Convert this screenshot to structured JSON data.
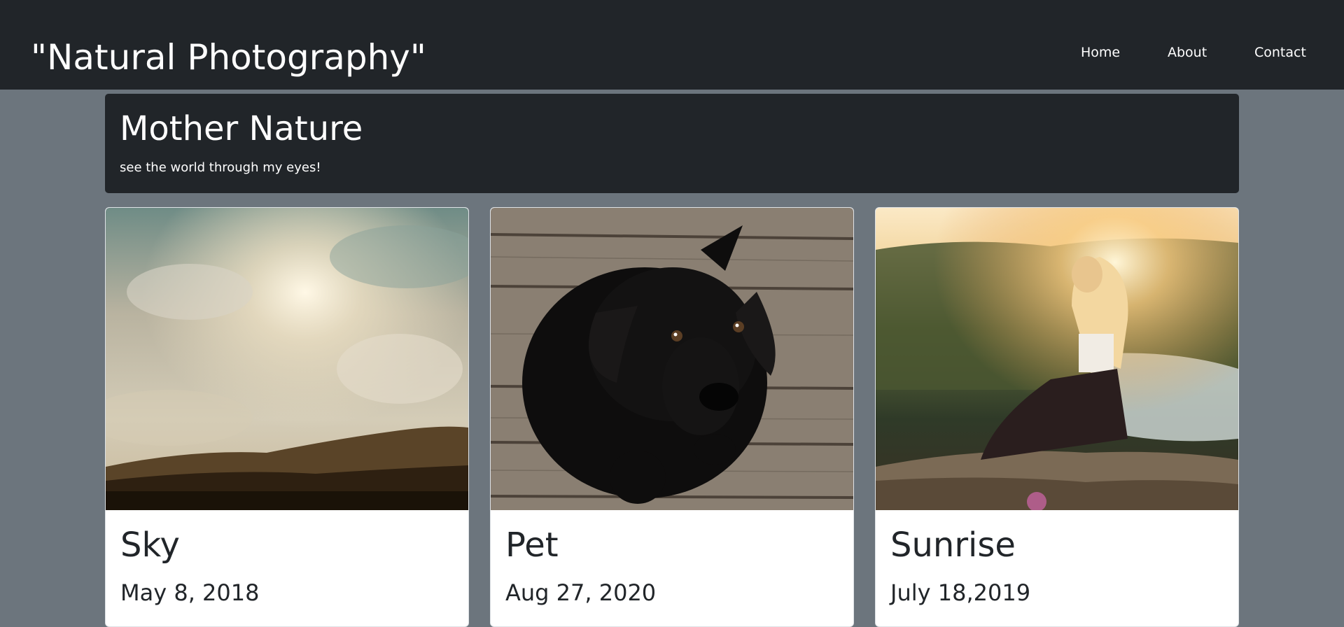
{
  "navbar": {
    "brand": "\"Natural Photography\"",
    "links": [
      {
        "label": "Home"
      },
      {
        "label": "About"
      },
      {
        "label": "Contact"
      }
    ]
  },
  "jumbotron": {
    "title": "Mother Nature",
    "subtitle": "see the world through my eyes!"
  },
  "cards": [
    {
      "title": "Sky",
      "date": "May 8, 2018",
      "image": "sky-photo"
    },
    {
      "title": "Pet",
      "date": "Aug 27, 2020",
      "image": "black-puppy-photo"
    },
    {
      "title": "Sunrise",
      "date": "July 18,2019",
      "image": "woman-sunrise-photo"
    }
  ],
  "colors": {
    "navbar_bg": "#212529",
    "page_bg": "#6c757d",
    "card_bg": "#ffffff",
    "text_dark": "#212529"
  }
}
